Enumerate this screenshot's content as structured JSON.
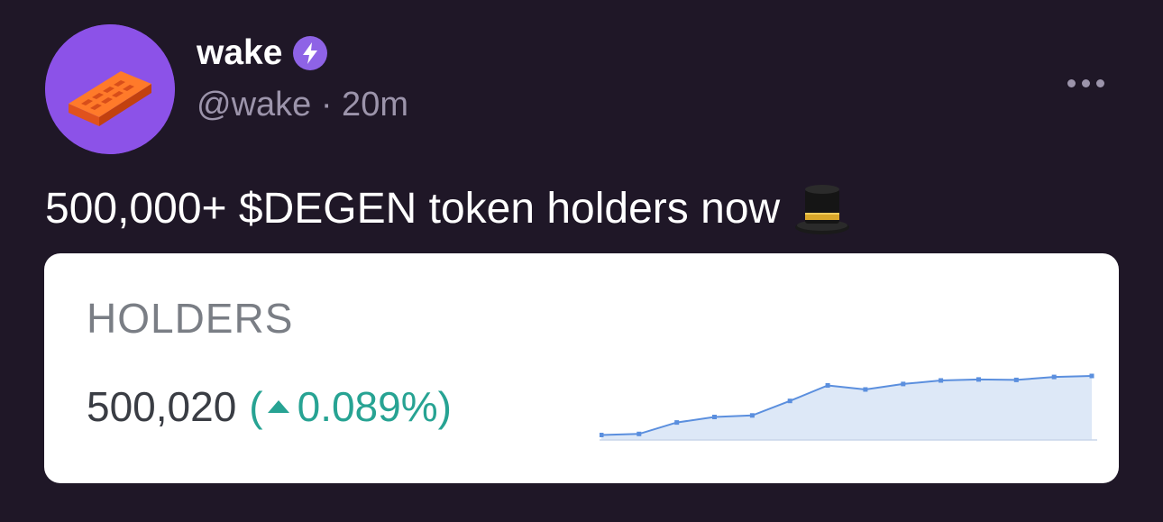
{
  "post": {
    "author": {
      "display_name": "wake",
      "badge_icon": "lightning-bolt-badge-icon",
      "badge_color": "#8e63e6"
    },
    "meta": "@wake · 20m",
    "text": "500,000+ $DEGEN token holders now",
    "text_emoji": "top-hat-icon",
    "more_icon": "ellipsis-icon"
  },
  "embed": {
    "label": "HOLDERS",
    "value": "500,020",
    "change_open": "(",
    "change_value": "0.089%)",
    "change_direction": "up",
    "change_color": "#27a393",
    "chart_data": {
      "type": "area",
      "values": [
        1.0,
        1.2,
        3.5,
        4.6,
        4.9,
        7.8,
        10.9,
        10.1,
        11.2,
        11.9,
        12.1,
        12.0,
        12.6,
        12.8
      ],
      "line_color": "#5b8fde",
      "fill_color": "#dde8f7",
      "grid": false
    }
  }
}
